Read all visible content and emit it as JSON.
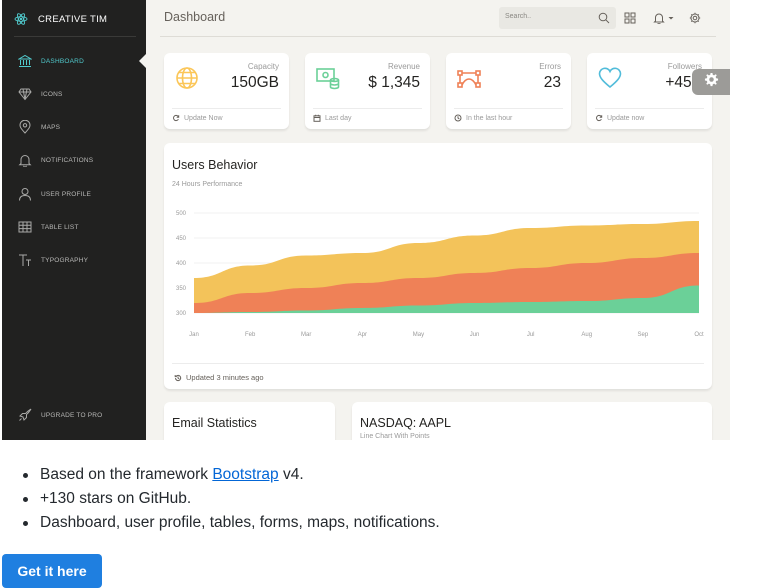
{
  "sidebar": {
    "brand": "CREATIVE TIM",
    "items": [
      {
        "label": "DASHBOARD",
        "icon": "bank-icon",
        "active": true
      },
      {
        "label": "ICONS",
        "icon": "diamond-icon",
        "active": false
      },
      {
        "label": "MAPS",
        "icon": "pin-icon",
        "active": false
      },
      {
        "label": "NOTIFICATIONS",
        "icon": "bell-icon",
        "active": false
      },
      {
        "label": "USER PROFILE",
        "icon": "user-icon",
        "active": false
      },
      {
        "label": "TABLE LIST",
        "icon": "table-icon",
        "active": false
      },
      {
        "label": "TYPOGRAPHY",
        "icon": "typography-icon",
        "active": false
      }
    ],
    "upgrade": "UPGRADE TO PRO"
  },
  "topbar": {
    "title": "Dashboard",
    "search_placeholder": "Search.."
  },
  "stats": [
    {
      "label": "Capacity",
      "value": "150GB",
      "footer": "Update Now",
      "color": "#fbc658",
      "icon": "globe-icon",
      "footer_icon": "refresh-icon"
    },
    {
      "label": "Revenue",
      "value": "$ 1,345",
      "footer": "Last day",
      "color": "#6bd098",
      "icon": "money-icon",
      "footer_icon": "calendar-icon"
    },
    {
      "label": "Errors",
      "value": "23",
      "footer": "In the last hour",
      "color": "#ef8157",
      "icon": "vector-icon",
      "footer_icon": "clock-icon"
    },
    {
      "label": "Followers",
      "value": "+45K",
      "footer": "Update now",
      "color": "#51bcda",
      "icon": "heart-icon",
      "footer_icon": "refresh-icon"
    }
  ],
  "chart_data": {
    "type": "area",
    "title": "Users Behavior",
    "subtitle": "24 Hours Performance",
    "categories": [
      "Jan",
      "Feb",
      "Mar",
      "Apr",
      "May",
      "Jun",
      "Jul",
      "Aug",
      "Sep",
      "Oct"
    ],
    "yticks": [
      300,
      350,
      400,
      450,
      500
    ],
    "ylim": [
      300,
      500
    ],
    "series": [
      {
        "color": "#6bd098",
        "values": [
          300,
          302,
          305,
          310,
          315,
          320,
          322,
          324,
          330,
          355
        ]
      },
      {
        "color": "#ef8157",
        "values": [
          320,
          340,
          350,
          360,
          370,
          380,
          390,
          400,
          410,
          420
        ]
      },
      {
        "color": "#f3c35a",
        "values": [
          370,
          395,
          415,
          420,
          440,
          455,
          470,
          475,
          478,
          484
        ]
      }
    ],
    "footer": "Updated 3 minutes ago"
  },
  "email_card": {
    "title": "Email Statistics"
  },
  "nasdaq_card": {
    "title": "NASDAQ: AAPL",
    "subtitle": "Line Chart With Points"
  },
  "readme": {
    "bullet1_pre": "Based on the framework ",
    "bullet1_link": "Bootstrap",
    "bullet1_post": " v4.",
    "bullet2": "+130 stars on GitHub.",
    "bullet3": "Dashboard, user profile, tables, forms, maps, notifications.",
    "cta": "Get it here"
  }
}
